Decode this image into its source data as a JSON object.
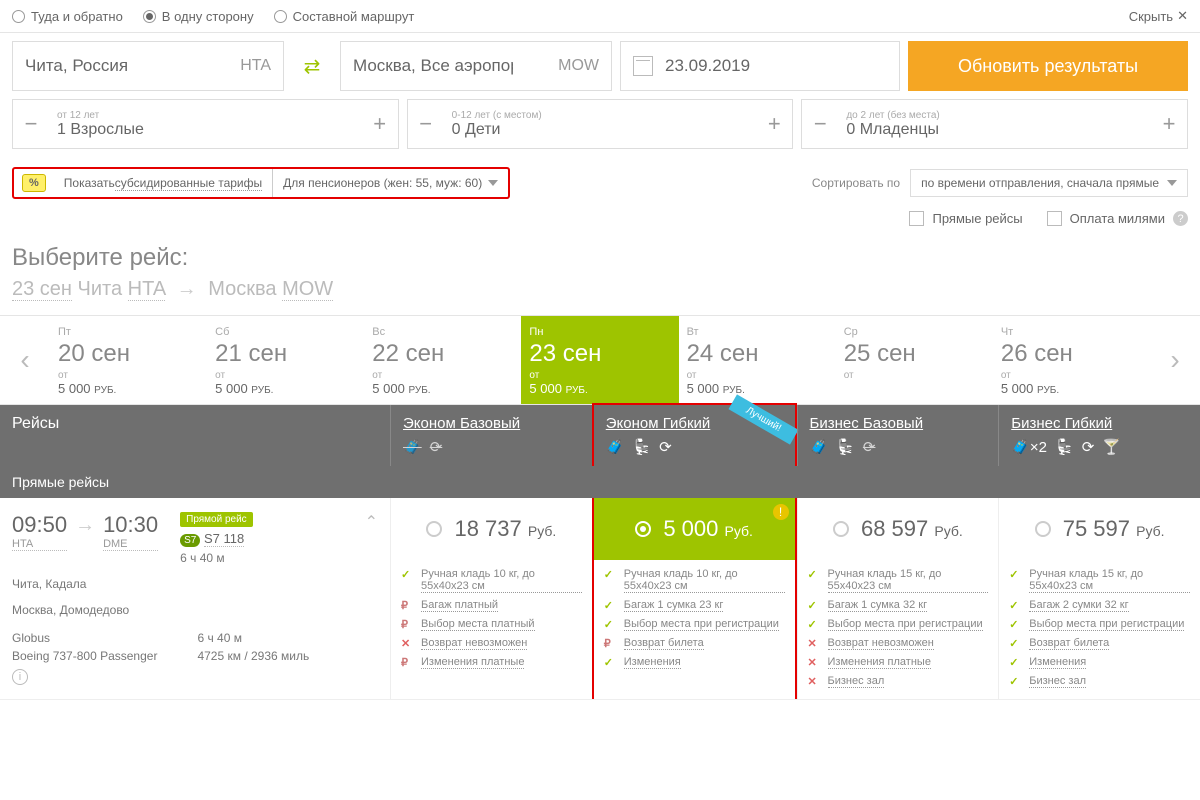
{
  "tripTypes": {
    "roundtrip": "Туда и обратно",
    "oneway": "В одну сторону",
    "multi": "Составной маршрут",
    "selected": "oneway"
  },
  "hide": "Скрыть",
  "from": {
    "city": "Чита, Россия",
    "code": "HTA"
  },
  "to": {
    "city": "Москва, Все аэропорты",
    "code": "MOW"
  },
  "date": "23.09.2019",
  "updateBtn": "Обновить результаты",
  "pax": {
    "adult": {
      "hint": "от 12 лет",
      "val": "1 Взрослые"
    },
    "child": {
      "hint": "0-12 лет (с местом)",
      "val": "0 Дети"
    },
    "infant": {
      "hint": "до 2 лет (без места)",
      "val": "0 Младенцы"
    }
  },
  "subsidy": {
    "show": "Показать ",
    "link": "субсидированные тарифы",
    "option": "Для пенсионеров (жен: 55, муж: 60)"
  },
  "sort": {
    "label": "Сортировать по",
    "value": "по времени отправления, сначала прямые"
  },
  "checks": {
    "direct": "Прямые рейсы",
    "miles": "Оплата милями"
  },
  "selectFlight": "Выберите рейс:",
  "route": {
    "date": "23 сен",
    "fromCity": "Чита",
    "fromCode": "HTA",
    "toCity": "Москва",
    "toCode": "MOW"
  },
  "dates": [
    {
      "dow": "Пт",
      "day": "20 сен",
      "price": "5 000"
    },
    {
      "dow": "Сб",
      "day": "21 сен",
      "price": "5 000"
    },
    {
      "dow": "Вс",
      "day": "22 сен",
      "price": "5 000"
    },
    {
      "dow": "Пн",
      "day": "23 сен",
      "price": "5 000",
      "active": true
    },
    {
      "dow": "Вт",
      "day": "24 сен",
      "price": "5 000"
    },
    {
      "dow": "Ср",
      "day": "25 сен",
      "price": ""
    },
    {
      "dow": "Чт",
      "day": "26 сен",
      "price": "5 000"
    }
  ],
  "ot": "от",
  "rub": "РУБ.",
  "fareHeader": {
    "flights": "Рейсы",
    "cols": [
      "Эконом Базовый",
      "Эконом Гибкий",
      "Бизнес Базовый",
      "Бизнес Гибкий"
    ],
    "best": "Лучший!"
  },
  "directHeader": "Прямые рейсы",
  "flight": {
    "depTime": "09:50",
    "depCode": "HTA",
    "arrTime": "10:30",
    "arrCode": "DME",
    "direct": "Прямой рейс",
    "num": "S7 118",
    "dur": "6 ч 40 м",
    "fromFull": "Чита, Кадала",
    "toFull": "Москва, Домодедово",
    "carrier": "Globus",
    "aircraft": "Boeing 737-800 Passenger",
    "dur2": "6 ч 40 м",
    "dist": "4725 км / 2936 миль"
  },
  "prices": [
    "18 737",
    "5 000",
    "68 597",
    "75 597"
  ],
  "priceCur": "Руб.",
  "features": {
    "col0": [
      {
        "ic": "check",
        "t": "Ручная кладь 10 кг, до 55х40х23 см"
      },
      {
        "ic": "rub",
        "t": "Багаж платный"
      },
      {
        "ic": "rub",
        "t": "Выбор места платный"
      },
      {
        "ic": "x",
        "t": "Возврат невозможен"
      },
      {
        "ic": "rub",
        "t": "Изменения платные"
      }
    ],
    "col1": [
      {
        "ic": "check",
        "t": "Ручная кладь 10 кг, до 55х40х23 см"
      },
      {
        "ic": "check",
        "t": "Багаж 1 сумка 23 кг"
      },
      {
        "ic": "check",
        "t": "Выбор места при регистрации"
      },
      {
        "ic": "rub",
        "t": "Возврат билета"
      },
      {
        "ic": "check",
        "t": "Изменения"
      }
    ],
    "col2": [
      {
        "ic": "check",
        "t": "Ручная кладь 15 кг, до 55х40х23 см"
      },
      {
        "ic": "check",
        "t": "Багаж 1 сумка 32 кг"
      },
      {
        "ic": "check",
        "t": "Выбор места при регистрации"
      },
      {
        "ic": "x",
        "t": "Возврат невозможен"
      },
      {
        "ic": "x",
        "t": "Изменения платные"
      },
      {
        "ic": "x",
        "t": "Бизнес зал"
      }
    ],
    "col3": [
      {
        "ic": "check",
        "t": "Ручная кладь 15 кг, до 55х40х23 см"
      },
      {
        "ic": "check",
        "t": "Багаж 2 сумки 32 кг"
      },
      {
        "ic": "check",
        "t": "Выбор места при регистрации"
      },
      {
        "ic": "check",
        "t": "Возврат билета"
      },
      {
        "ic": "check",
        "t": "Изменения"
      },
      {
        "ic": "check",
        "t": "Бизнес зал"
      }
    ]
  }
}
